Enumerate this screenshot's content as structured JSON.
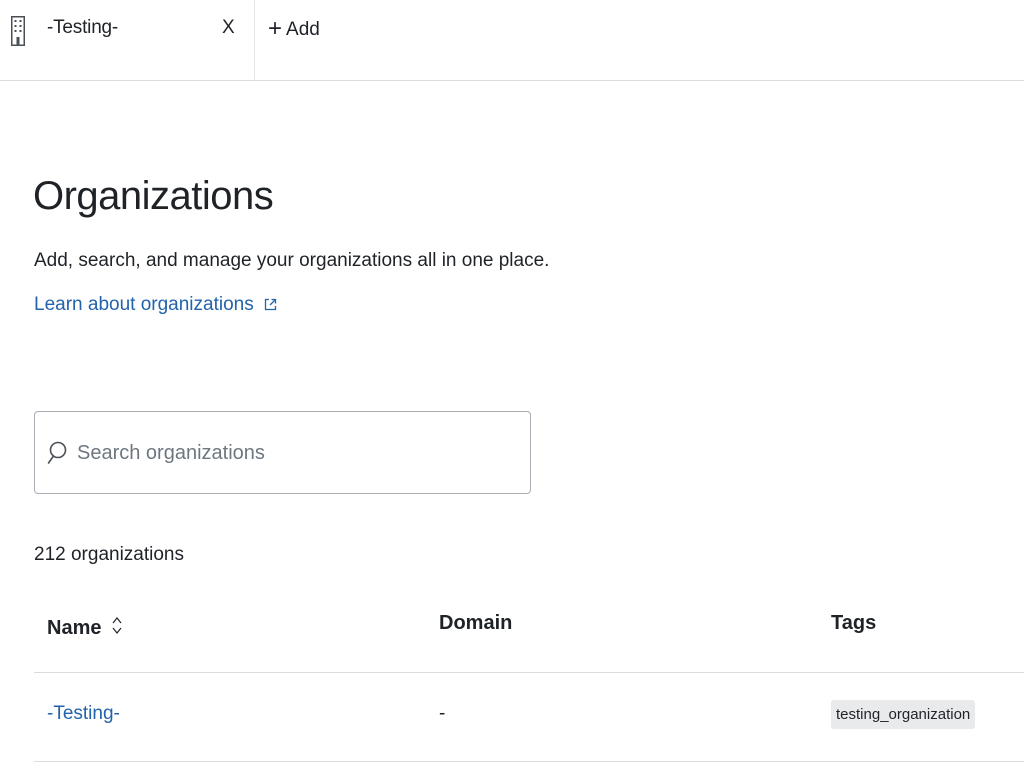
{
  "tabs": {
    "active": {
      "label": "-Testing-",
      "close": "X"
    },
    "add_label": "Add",
    "add_symbol": "+"
  },
  "main": {
    "title": "Organizations",
    "subtitle": "Add, search, and manage your organizations all in one place.",
    "learn_link": "Learn about organizations"
  },
  "search": {
    "placeholder": "Search organizations",
    "value": ""
  },
  "result_count": "212 organizations",
  "table": {
    "columns": [
      "Name",
      "Domain",
      "Tags"
    ],
    "rows": [
      {
        "name": "-Testing-",
        "domain": "-",
        "tag": "testing_organization"
      }
    ]
  },
  "colors": {
    "link": "#2263ab",
    "text": "#1f2328",
    "border": "#d9dcde",
    "tag_bg": "#e8eaec"
  },
  "icons": {
    "tab_icon": "building-icon",
    "close": "close-icon",
    "add": "plus-icon",
    "external": "external-link-icon",
    "search": "search-icon",
    "sort": "sort-icon"
  }
}
